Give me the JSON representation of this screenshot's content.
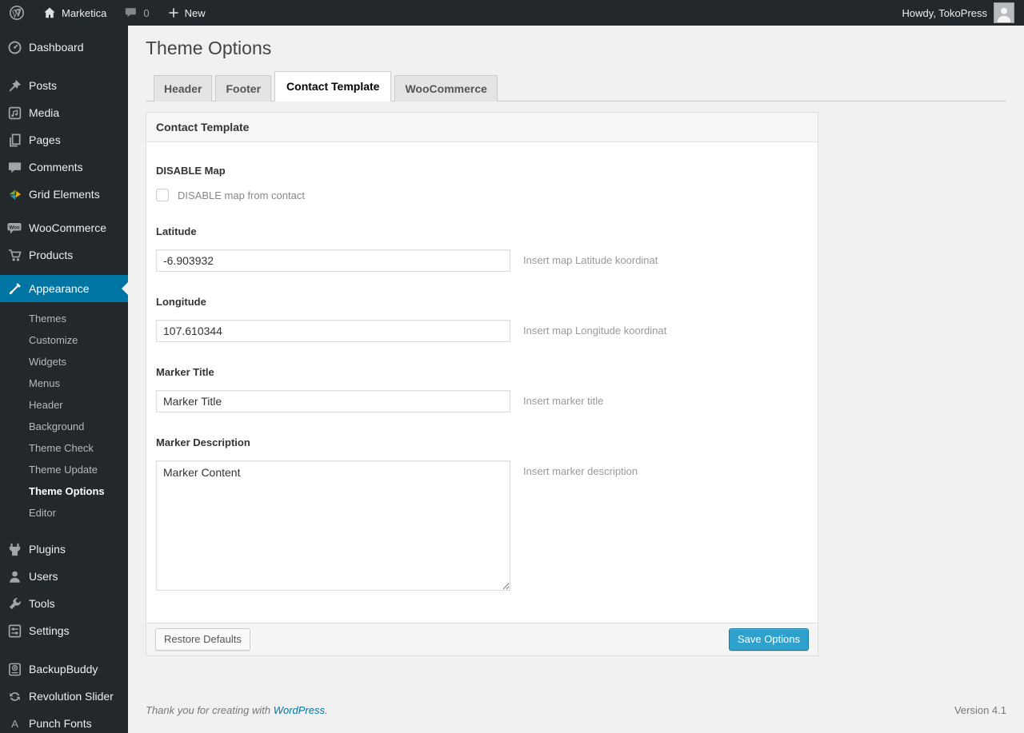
{
  "admin_bar": {
    "site_name": "Marketica",
    "comments_count": "0",
    "new_label": "New",
    "howdy": "Howdy, TokoPress"
  },
  "sidebar": {
    "items": [
      "Dashboard",
      "Posts",
      "Media",
      "Pages",
      "Comments",
      "Grid Elements",
      "WooCommerce",
      "Products",
      "Appearance",
      "Plugins",
      "Users",
      "Tools",
      "Settings",
      "BackupBuddy",
      "Revolution Slider",
      "Punch Fonts"
    ],
    "appearance_submenu": [
      "Themes",
      "Customize",
      "Widgets",
      "Menus",
      "Header",
      "Background",
      "Theme Check",
      "Theme Update",
      "Theme Options",
      "Editor"
    ],
    "current_submenu_item": "Theme Options"
  },
  "main": {
    "page_title": "Theme Options",
    "tabs": [
      {
        "label": "Header",
        "active": false
      },
      {
        "label": "Footer",
        "active": false
      },
      {
        "label": "Contact Template",
        "active": true
      },
      {
        "label": "WooCommerce",
        "active": false
      }
    ],
    "panel_title": "Contact Template",
    "fields": {
      "disable_map": {
        "label": "DISABLE Map",
        "checkbox_label": "DISABLE map from contact",
        "checked": false
      },
      "latitude": {
        "label": "Latitude",
        "value": "-6.903932",
        "hint": "Insert map Latitude koordinat"
      },
      "longitude": {
        "label": "Longitude",
        "value": "107.610344",
        "hint": "Insert map Longitude koordinat"
      },
      "marker_title": {
        "label": "Marker Title",
        "value": "Marker Title",
        "hint": "Insert marker title"
      },
      "marker_description": {
        "label": "Marker Description",
        "value": "Marker Content",
        "hint": "Insert marker description"
      }
    },
    "buttons": {
      "restore": "Restore Defaults",
      "save": "Save Options"
    }
  },
  "footer": {
    "thanks_text": "Thank you for creating with ",
    "link_label": "WordPress",
    "suffix": ".",
    "version": "Version 4.1"
  },
  "colors": {
    "admin_bar_bg": "#23282d",
    "menu_active": "#0074a2",
    "primary_button": "#2ea2cc",
    "page_bg": "#f1f1f1"
  }
}
